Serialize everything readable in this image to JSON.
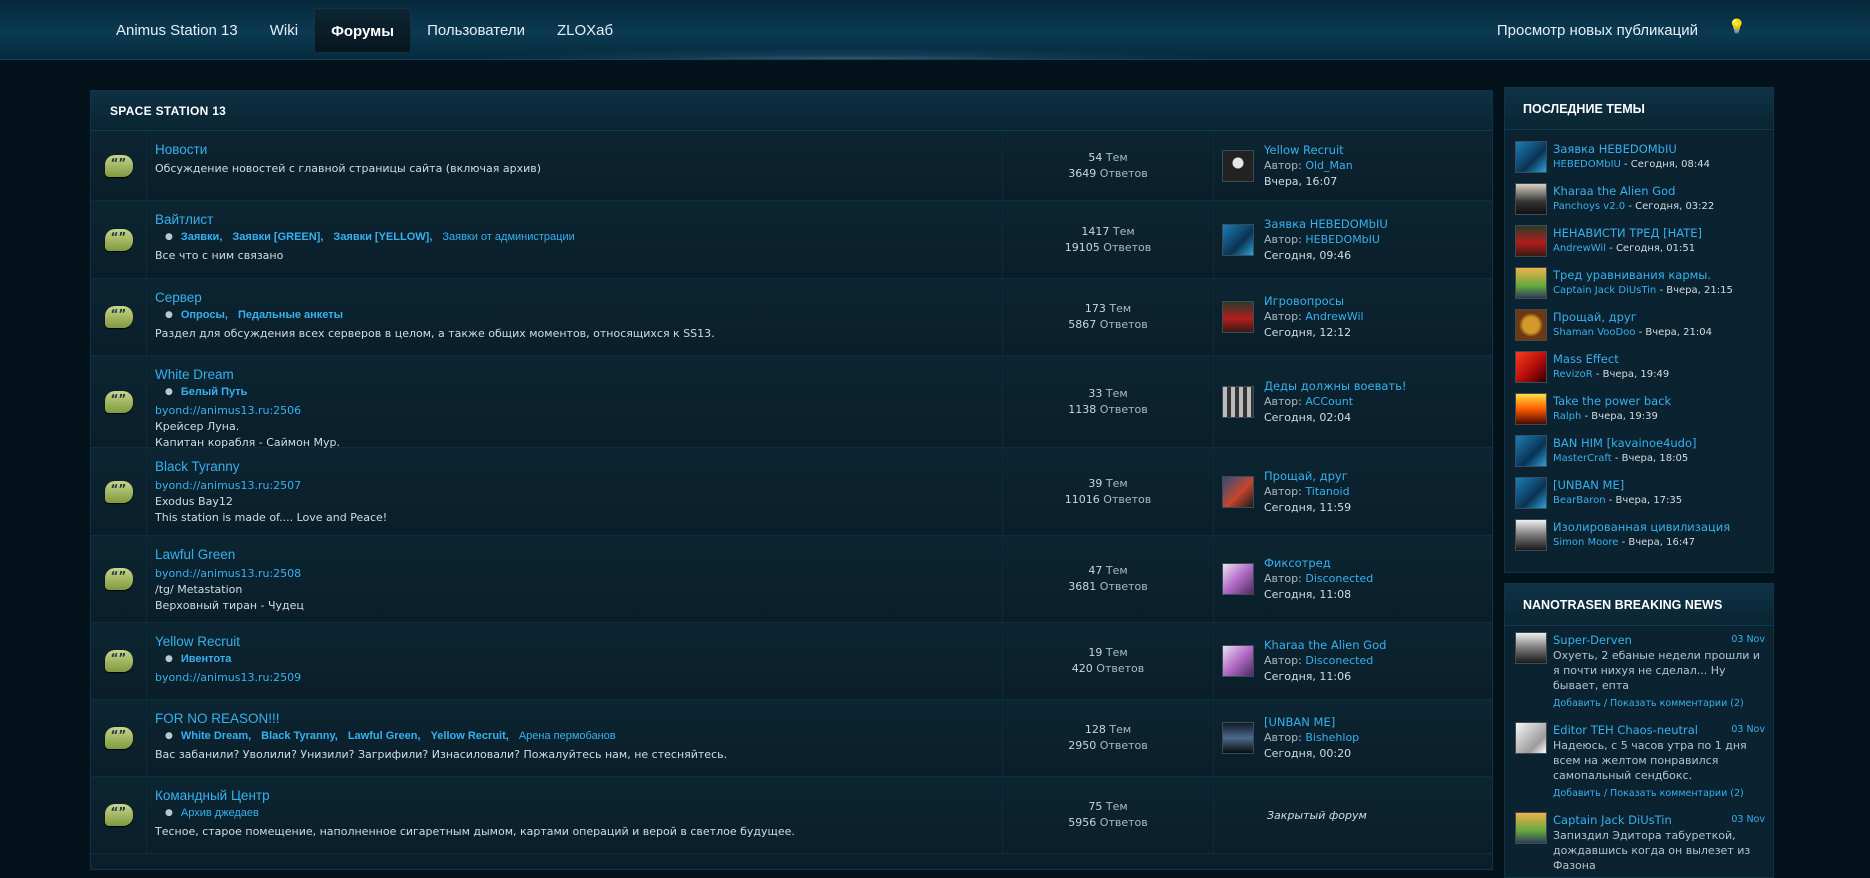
{
  "nav": {
    "items": [
      "Animus Station 13",
      "Wiki",
      "Форумы",
      "Пользователи",
      "ZLOXаб"
    ],
    "active_index": 2,
    "new_posts": "Просмотр новых публикаций"
  },
  "section": {
    "title": "SPACE STATION 13",
    "forums": [
      {
        "title": "Новости",
        "subforums": [],
        "lines": [
          {
            "text": "Обсуждение новостей с главной страницы сайта (включая архив)",
            "link": false
          }
        ],
        "topics": "54",
        "replies": "3649",
        "topics_label": "Тем",
        "replies_label": "Ответов",
        "last": {
          "title": "Yellow Recruit",
          "author_label": "Автор:",
          "author": "Old_Man",
          "date": "Вчера, 16:07",
          "avatar": "av-dark"
        }
      },
      {
        "title": "Вайтлист",
        "subforums": [
          {
            "label": "Заявки",
            "bold": true,
            "sep": ","
          },
          {
            "label": "Заявки [GREEN]",
            "bold": true,
            "sep": ","
          },
          {
            "label": "Заявки [YELLOW]",
            "bold": true,
            "sep": ","
          },
          {
            "label": "Заявки от администрации",
            "bold": false,
            "sep": ""
          }
        ],
        "lines": [
          {
            "text": "Все что с ним связано",
            "link": false
          }
        ],
        "topics": "1417",
        "replies": "19105",
        "topics_label": "Тем",
        "replies_label": "Ответов",
        "last": {
          "title": "Заявка HEBEDOMbIU",
          "author_label": "Автор:",
          "author": "HEBEDOMbIU",
          "date": "Сегодня, 09:46",
          "avatar": "av-blue"
        }
      },
      {
        "title": "Сервер",
        "subforums": [
          {
            "label": "Опросы",
            "bold": true,
            "sep": ","
          },
          {
            "label": "Педальные анкеты",
            "bold": true,
            "sep": ""
          }
        ],
        "lines": [
          {
            "text": "Раздел для обсуждения всех серверов в целом, а также общих моментов, относящихся к SS13.",
            "link": false
          }
        ],
        "topics": "173",
        "replies": "5867",
        "topics_label": "Тем",
        "replies_label": "Ответов",
        "last": {
          "title": "Игровопросы",
          "author_label": "Автор:",
          "author": "AndrewWil",
          "date": "Сегодня, 12:12",
          "avatar": "av-red"
        }
      },
      {
        "title": "White Dream",
        "subforums": [
          {
            "label": "Белый Путь",
            "bold": true,
            "sep": ""
          }
        ],
        "lines": [
          {
            "text": "byond://animus13.ru:2506",
            "link": true
          },
          {
            "text": "Крейсер Луна.",
            "link": false
          },
          {
            "text": "Капитан корабля - Саймон Мур.",
            "link": false
          }
        ],
        "topics": "33",
        "replies": "1138",
        "topics_label": "Тем",
        "replies_label": "Ответов",
        "last": {
          "title": "Деды должны воевать!",
          "author_label": "Автор:",
          "author": "ACCount",
          "date": "Сегодня, 02:04",
          "avatar": "av-grid"
        }
      },
      {
        "title": "Black Tyranny",
        "subforums": [],
        "lines": [
          {
            "text": "byond://animus13.ru:2507",
            "link": true
          },
          {
            "text": "Exodus Bay12",
            "link": false
          },
          {
            "text": "This station is made of.... Love and Peace!",
            "link": false
          }
        ],
        "topics": "39",
        "replies": "11016",
        "topics_label": "Тем",
        "replies_label": "Ответов",
        "last": {
          "title": "Прощай, друг",
          "author_label": "Автор:",
          "author": "Titanoid",
          "date": "Сегодня, 11:59",
          "avatar": "av-anime"
        }
      },
      {
        "title": "Lawful Green",
        "subforums": [],
        "lines": [
          {
            "text": "byond://animus13.ru:2508",
            "link": true
          },
          {
            "text": "/tg/ Metastation",
            "link": false
          },
          {
            "text": "Верховный тиран - Чудец",
            "link": false
          }
        ],
        "topics": "47",
        "replies": "3681",
        "topics_label": "Тем",
        "replies_label": "Ответов",
        "last": {
          "title": "Фиксотред",
          "author_label": "Автор:",
          "author": "Disconected",
          "date": "Сегодня, 11:08",
          "avatar": "av-pony"
        }
      },
      {
        "title": "Yellow Recruit",
        "subforums": [
          {
            "label": "Ивентота",
            "bold": true,
            "sep": ""
          }
        ],
        "lines": [
          {
            "text": "byond://animus13.ru:2509",
            "link": true
          }
        ],
        "topics": "19",
        "replies": "420",
        "topics_label": "Тем",
        "replies_label": "Ответов",
        "last": {
          "title": "Kharaa the Alien God",
          "author_label": "Автор:",
          "author": "Disconected",
          "date": "Сегодня, 11:06",
          "avatar": "av-pony"
        }
      },
      {
        "title": "FOR NO REASON!!!",
        "subforums": [
          {
            "label": "White Dream",
            "bold": true,
            "sep": ","
          },
          {
            "label": "Black Tyranny",
            "bold": true,
            "sep": ","
          },
          {
            "label": "Lawful Green",
            "bold": true,
            "sep": ","
          },
          {
            "label": "Yellow Recruit",
            "bold": true,
            "sep": ","
          },
          {
            "label": "Арена пермобанов",
            "bold": false,
            "sep": ""
          }
        ],
        "lines": [
          {
            "text": "Вас забанили? Уволили? Унизили? Загрифили? Изнасиловали? Пожалуйтесь нам, не стесняйтесь.",
            "link": false
          }
        ],
        "topics": "128",
        "replies": "2950",
        "topics_label": "Тем",
        "replies_label": "Ответов",
        "last": {
          "title": "[UNBAN ME]",
          "author_label": "Автор:",
          "author": "Bishehlop",
          "date": "Сегодня, 00:20",
          "avatar": "av-car"
        }
      },
      {
        "title": "Командный Центр",
        "subforums": [
          {
            "label": "Архив джедаев",
            "bold": false,
            "sep": ""
          }
        ],
        "lines": [
          {
            "text": "Тесное, старое помещение, наполненное сигаретным дымом, картами операций и верой в светлое будущее.",
            "link": false
          }
        ],
        "topics": "75",
        "replies": "5956",
        "topics_label": "Тем",
        "replies_label": "Ответов",
        "closed": "Закрытый форум"
      }
    ]
  },
  "sidebar": {
    "latest_title": "ПОСЛЕДНИЕ ТЕМЫ",
    "latest": [
      {
        "title": "Заявка HEBEDOMbIU",
        "user": "HEBEDOMbIU",
        "date": " - Сегодня, 08:44",
        "avatar": "av-blue"
      },
      {
        "title": "Kharaa the Alien God",
        "user": "Panchoys v2.0",
        "date": " - Сегодня, 03:22",
        "avatar": "av-face"
      },
      {
        "title": "НЕНАВИСТИ ТРЕД [HATE]",
        "user": "AndrewWil",
        "date": " - Сегодня, 01:51",
        "avatar": "av-red"
      },
      {
        "title": "Тред уравнивания кармы.",
        "user": "Captain Jack DiUsTin",
        "date": " - Вчера, 21:15",
        "avatar": "av-cat"
      },
      {
        "title": "Прощай, друг",
        "user": "Shaman VooDoo",
        "date": " - Вчера, 21:04",
        "avatar": "av-lion"
      },
      {
        "title": "Mass Effect",
        "user": "RevizoR",
        "date": " - Вчера, 19:49",
        "avatar": "av-mass"
      },
      {
        "title": "Take the power back",
        "user": "Ralph",
        "date": " - Вчера, 19:39",
        "avatar": "av-fire"
      },
      {
        "title": "BAN HIM [kavainoe4udo]",
        "user": "MasterCraft",
        "date": " - Вчера, 18:05",
        "avatar": "av-blue"
      },
      {
        "title": "[UNBAN ME]",
        "user": "BearBaron",
        "date": " - Вчера, 17:35",
        "avatar": "av-blue"
      },
      {
        "title": "Изолированная цивилизация",
        "user": "Simon Moore",
        "date": " - Вчера, 16:47",
        "avatar": "av-wolf"
      }
    ],
    "news_title": "NANOTRASEN BREAKING NEWS",
    "news": [
      {
        "author": "Super-Derven",
        "date": "03 Nov",
        "text": "Охуеть, 2 ебаные недели прошли и я почти нихуя не сделал... Ну бывает, епта",
        "actions": "Добавить / Показать комментарии (2)",
        "avatar": "av-wolf"
      },
      {
        "author": "Editor TEH Chaos-neutral",
        "date": "03 Nov",
        "text": "Надеюсь, с 5 часов утра по 1 дня всем на желтом понравился самопальный сендбокс.",
        "actions": "Добавить / Показать комментарии (2)",
        "avatar": "av-sketch"
      },
      {
        "author": "Captain Jack DiUsTin",
        "date": "03 Nov",
        "text": "Запиздил Эдитора табуреткой, дождавшись когда он вылезет из Фазона",
        "actions": "",
        "avatar": "av-cat"
      }
    ]
  }
}
